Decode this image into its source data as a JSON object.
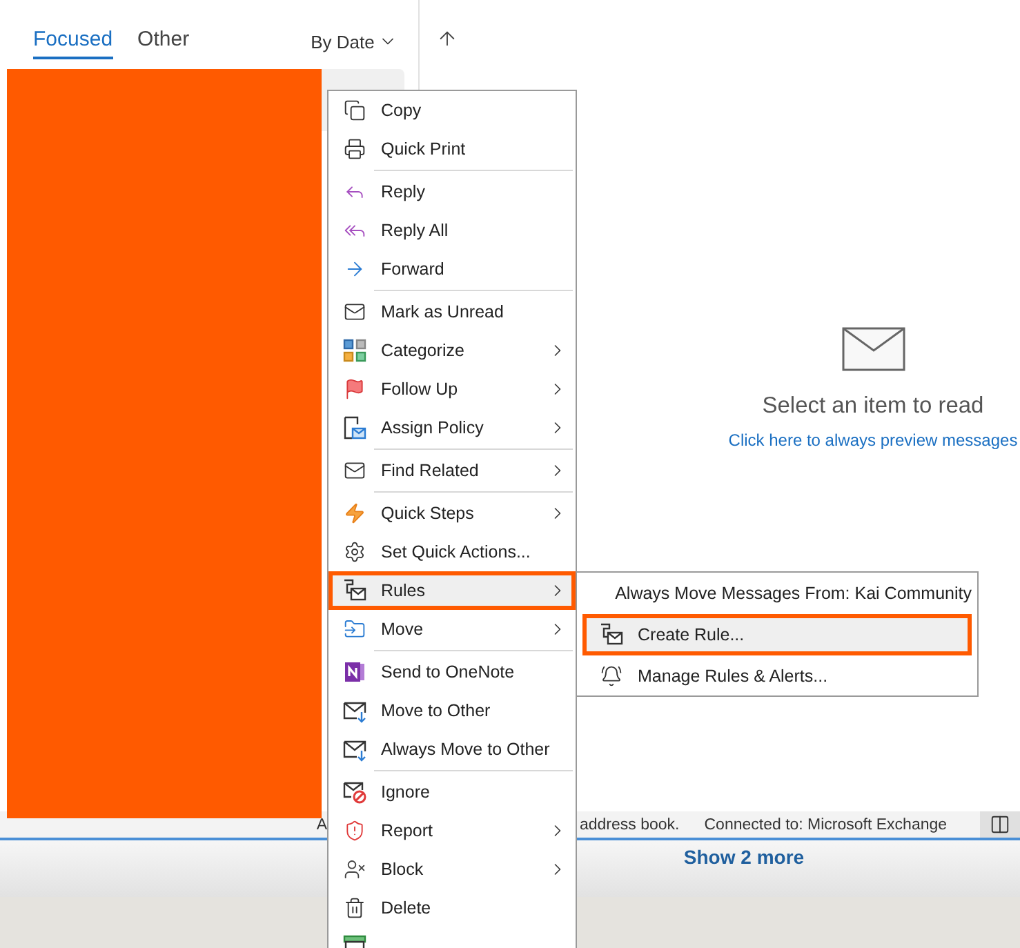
{
  "tabs": [
    {
      "label": "Focused",
      "selected": true
    },
    {
      "label": "Other",
      "selected": false
    }
  ],
  "sort": {
    "label": "By Date"
  },
  "reading_pane": {
    "message": "Select an item to read",
    "link": "Click here to always preview messages"
  },
  "context_menu": {
    "items": [
      {
        "kind": "item",
        "label": "Copy",
        "has_submenu": false,
        "selected": false,
        "annotated": false
      },
      {
        "kind": "item",
        "label": "Quick Print",
        "has_submenu": false,
        "selected": false,
        "annotated": false
      },
      {
        "kind": "separator"
      },
      {
        "kind": "item",
        "label": "Reply",
        "has_submenu": false,
        "selected": false,
        "annotated": false
      },
      {
        "kind": "item",
        "label": "Reply All",
        "has_submenu": false,
        "selected": false,
        "annotated": false
      },
      {
        "kind": "item",
        "label": "Forward",
        "has_submenu": false,
        "selected": false,
        "annotated": false
      },
      {
        "kind": "separator"
      },
      {
        "kind": "item",
        "label": "Mark as Unread",
        "has_submenu": false,
        "selected": false,
        "annotated": false
      },
      {
        "kind": "item",
        "label": "Categorize",
        "has_submenu": true,
        "selected": false,
        "annotated": false
      },
      {
        "kind": "item",
        "label": "Follow Up",
        "has_submenu": true,
        "selected": false,
        "annotated": false
      },
      {
        "kind": "item",
        "label": "Assign Policy",
        "has_submenu": true,
        "selected": false,
        "annotated": false
      },
      {
        "kind": "separator"
      },
      {
        "kind": "item",
        "label": "Find Related",
        "has_submenu": true,
        "selected": false,
        "annotated": false
      },
      {
        "kind": "separator"
      },
      {
        "kind": "item",
        "label": "Quick Steps",
        "has_submenu": true,
        "selected": false,
        "annotated": false
      },
      {
        "kind": "item",
        "label": "Set Quick Actions...",
        "has_submenu": false,
        "selected": false,
        "annotated": false
      },
      {
        "kind": "item",
        "label": "Rules",
        "has_submenu": true,
        "selected": true,
        "annotated": true
      },
      {
        "kind": "item",
        "label": "Move",
        "has_submenu": true,
        "selected": false,
        "annotated": false
      },
      {
        "kind": "separator"
      },
      {
        "kind": "item",
        "label": "Send to OneNote",
        "has_submenu": false,
        "selected": false,
        "annotated": false
      },
      {
        "kind": "item",
        "label": "Move to Other",
        "has_submenu": false,
        "selected": false,
        "annotated": false
      },
      {
        "kind": "item",
        "label": "Always Move to Other",
        "has_submenu": false,
        "selected": false,
        "annotated": false
      },
      {
        "kind": "separator"
      },
      {
        "kind": "item",
        "label": "Ignore",
        "has_submenu": false,
        "selected": false,
        "annotated": false
      },
      {
        "kind": "item",
        "label": "Report",
        "has_submenu": true,
        "selected": false,
        "annotated": false
      },
      {
        "kind": "item",
        "label": "Block",
        "has_submenu": true,
        "selected": false,
        "annotated": false
      },
      {
        "kind": "item",
        "label": "Delete",
        "has_submenu": false,
        "selected": false,
        "annotated": false
      },
      {
        "kind": "cut_item"
      }
    ]
  },
  "submenu": {
    "items": [
      {
        "label": "Always Move Messages From: Kai Community",
        "selected": false,
        "annotated": false
      },
      {
        "label": "Create Rule...",
        "selected": true,
        "annotated": true
      },
      {
        "label": "Manage Rules & Alerts...",
        "selected": false,
        "annotated": false
      }
    ]
  },
  "status_bar": {
    "left_fragment": "A",
    "middle_fragment": "address book.",
    "connection": "Connected to: Microsoft Exchange"
  },
  "show_more": "Show 2 more"
}
